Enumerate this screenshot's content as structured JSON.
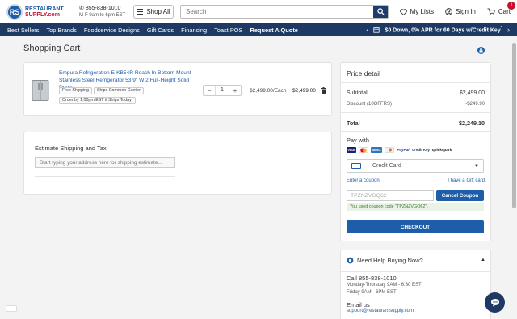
{
  "header": {
    "logo_line1": "RESTAURANT",
    "logo_line2": "SUPPLY.com",
    "logo_mark": "RS",
    "phone": "855-838-1010",
    "hours": "M-F 9am to 6pm EST",
    "shop_all": "Shop All",
    "search_placeholder": "Search",
    "my_lists": "My Lists",
    "sign_in": "Sign In",
    "cart": "Cart",
    "cart_count": "1"
  },
  "nav": {
    "items": [
      "Best Sellers",
      "Top Brands",
      "Foodservice Designs",
      "Gift Cards",
      "Financing",
      "Toast POS",
      "Request A Quote"
    ],
    "promo": "$0 Down, 0% APR for 60 Days w/Credit Key",
    "promo_sup": "*"
  },
  "page": {
    "title": "Shopping Cart"
  },
  "cart_item": {
    "title": "Empura Refrigeration E-KB54R Reach In Bottom-Mount Stainless Steel Refrigerator 53.9\" W 2 Full-Height Solid Doors...",
    "tags": [
      "Free Shipping",
      "Ships Common Carrier",
      "Order by 1:00pm EST it Ships Today!"
    ],
    "quantity": "1",
    "price_each": "$2,499.00/Each",
    "price_total": "$2,499.00"
  },
  "shipping": {
    "title": "Estimate Shipping and Tax",
    "placeholder": "Start typing your address here for shipping estimate..."
  },
  "price_detail": {
    "title": "Price detail",
    "subtotal_label": "Subtotal",
    "subtotal_value": "$2,499.00",
    "discount_label": "Discount (10OFFRS)",
    "discount_value": "-$249.90",
    "total_label": "Total",
    "total_value": "$2,249.10",
    "pay_with": "Pay with",
    "pay_icons": [
      "visa",
      "mastercard",
      "amex",
      "discover",
      "PayPal",
      "CreditKey",
      "quickspark"
    ],
    "pay_icon_labels": [
      "VISA",
      "",
      "AMEX",
      "",
      "PayPal",
      "Credit Key",
      "quickspark"
    ],
    "payment_method": "Credit Card",
    "enter_coupon": "Enter a coupon",
    "gift_card": "I have a Gift card",
    "coupon_value": "TPZNZVGQ62",
    "cancel_coupon": "Cancel Coupon",
    "coupon_message": "You used coupon code \"TPZNZVGQ62\".",
    "checkout": "CHECKOUT"
  },
  "help": {
    "title": "Need Help Buying Now?",
    "call": "Call 855-838-1010",
    "hours1": "Monday-Thursday 9AM - 6:30 EST",
    "hours2": "Friday 9AM - 6PM EST",
    "email_label": "Email us",
    "email": "support@restaurantsupply.com"
  },
  "colors": {
    "brand": "#1e5ea8",
    "nav_bg": "#1e3a64",
    "badge": "#c8102e"
  }
}
